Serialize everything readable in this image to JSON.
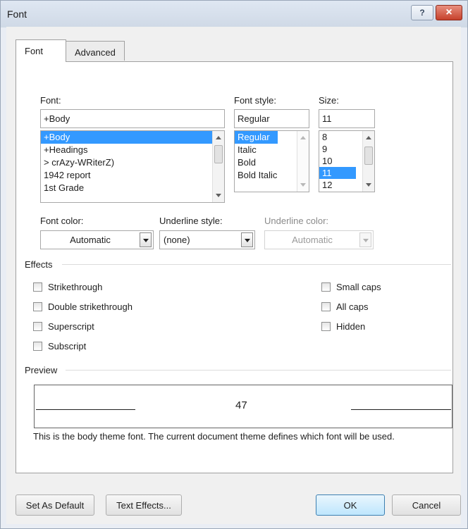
{
  "window": {
    "title": "Font",
    "help_glyph": "?",
    "close_glyph": "×"
  },
  "tabs": [
    {
      "label": "Font",
      "active": true
    },
    {
      "label": "Advanced",
      "active": false
    }
  ],
  "font": {
    "label": "Font:",
    "value": "+Body",
    "list": [
      "+Body",
      "+Headings",
      "> crAzy-WRiterZ)",
      "1942 report",
      "1st Grade"
    ],
    "selected_index": 0
  },
  "font_style": {
    "label": "Font style:",
    "value": "Regular",
    "list": [
      "Regular",
      "Italic",
      "Bold",
      "Bold Italic"
    ],
    "selected_index": 0
  },
  "size": {
    "label": "Size:",
    "value": "11",
    "list": [
      "8",
      "9",
      "10",
      "11",
      "12"
    ],
    "selected_index": 3
  },
  "font_color": {
    "label": "Font color:",
    "value": "Automatic"
  },
  "underline_style": {
    "label": "Underline style:",
    "value": "(none)"
  },
  "underline_color": {
    "label": "Underline color:",
    "value": "Automatic",
    "disabled": true
  },
  "effects": {
    "title": "Effects",
    "left": [
      {
        "label": "Strikethrough",
        "checked": false
      },
      {
        "label": "Double strikethrough",
        "checked": false
      },
      {
        "label": "Superscript",
        "checked": false
      },
      {
        "label": "Subscript",
        "checked": false
      }
    ],
    "right": [
      {
        "label": "Small caps",
        "checked": false
      },
      {
        "label": "All caps",
        "checked": false
      },
      {
        "label": "Hidden",
        "checked": false
      }
    ]
  },
  "preview": {
    "title": "Preview",
    "sample_text": "47",
    "description": "This is the body theme font. The current document theme defines which font will be used."
  },
  "buttons": {
    "set_default": "Set As Default",
    "text_effects": "Text Effects...",
    "ok": "OK",
    "cancel": "Cancel"
  },
  "colors": {
    "selection": "#3399ff",
    "close_button": "#c6402b",
    "default_button": "#bee6fd"
  }
}
